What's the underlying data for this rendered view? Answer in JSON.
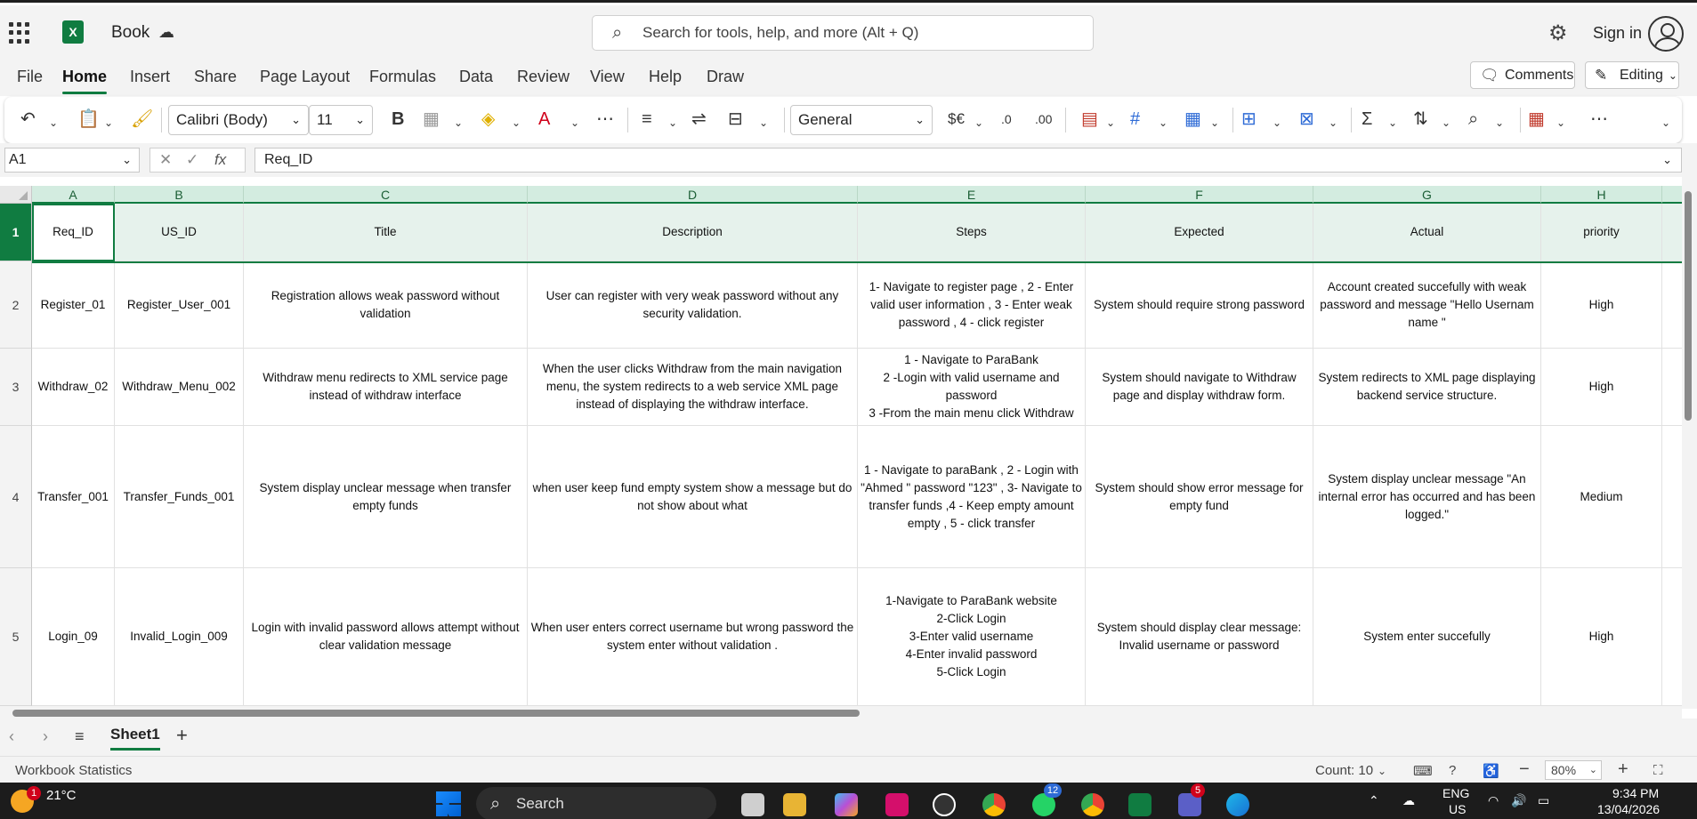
{
  "titlebar": {
    "doc_name": "Book",
    "search_placeholder": "Search for tools, help, and more (Alt + Q)",
    "sign_in": "Sign in"
  },
  "menu": {
    "items": [
      "File",
      "Home",
      "Insert",
      "Share",
      "Page Layout",
      "Formulas",
      "Data",
      "Review",
      "View",
      "Help",
      "Draw"
    ],
    "active": "Home",
    "comments": "Comments",
    "editing": "Editing"
  },
  "ribbon": {
    "font_name": "Calibri (Body)",
    "font_size": "11",
    "number_format": "General",
    "bold": "B"
  },
  "formula_bar": {
    "name_box": "A1",
    "formula": "Req_ID",
    "fx": "fx"
  },
  "grid": {
    "columns": [
      "A",
      "B",
      "C",
      "D",
      "E",
      "F",
      "G",
      "H"
    ],
    "rows": [
      {
        "num": "1",
        "cells": [
          "Req_ID",
          "US_ID",
          "Title",
          "Description",
          "Steps",
          "Expected",
          "Actual",
          "priority"
        ]
      },
      {
        "num": "2",
        "cells": [
          "Register_01",
          "Register_User_001",
          "Registration allows weak password without validation",
          "User can register with very weak password without any security validation.",
          "1- Navigate to register page , 2 - Enter valid user information , 3 - Enter weak password , 4 - click register",
          "System should require strong password",
          "Account created succefully with weak password and message \"Hello Usernam name \"",
          "High"
        ]
      },
      {
        "num": "3",
        "cells": [
          "Withdraw_02",
          "Withdraw_Menu_002",
          "Withdraw menu redirects to XML service page instead of withdraw interface",
          "When the user clicks Withdraw from the main navigation menu, the system redirects to a web service XML page instead of displaying the withdraw interface.",
          "1 - Navigate to ParaBank\n2 -Login with valid username and password\n3 -From the main menu click Withdraw",
          "System should navigate to Withdraw page and display withdraw form.",
          "System redirects to XML page displaying backend service structure.",
          "High"
        ]
      },
      {
        "num": "4",
        "cells": [
          "Transfer_001",
          "Transfer_Funds_001",
          "System display unclear message when transfer empty funds",
          "when user keep fund empty system show a message but do not show about  what",
          "1 - Navigate to paraBank , 2 - Login with \"Ahmed \" password \"123\" , 3- Navigate to transfer funds ,4 - Keep empty amount empty , 5 - click transfer",
          "System should show error message for empty fund",
          "System display unclear message  \"An internal error has occurred and has been logged.\"",
          "Medium"
        ]
      },
      {
        "num": "5",
        "cells": [
          "Login_09",
          "Invalid_Login_009",
          "Login with invalid password allows attempt without clear validation message",
          "When user enters correct username but wrong password the system enter without validation .",
          "1-Navigate to ParaBank website\n2-Click Login\n3-Enter valid username\n4-Enter invalid password\n5-Click Login",
          "System should display clear message: Invalid username or password",
          "System enter succefully",
          "High"
        ]
      }
    ]
  },
  "sheet": {
    "tab": "Sheet1"
  },
  "status": {
    "left": "Workbook Statistics",
    "count": "Count: 10",
    "zoom": "80%"
  },
  "taskbar": {
    "temp": "21°C",
    "search": "Search",
    "lang1": "ENG",
    "lang2": "US",
    "time": "9:34 PM",
    "date": "13/04/2026",
    "badge_weather": "1",
    "badge_whatsapp": "12",
    "badge_teams": "5"
  },
  "colors": {
    "accent": "#107c41",
    "header_fill": "#d3ece0"
  }
}
